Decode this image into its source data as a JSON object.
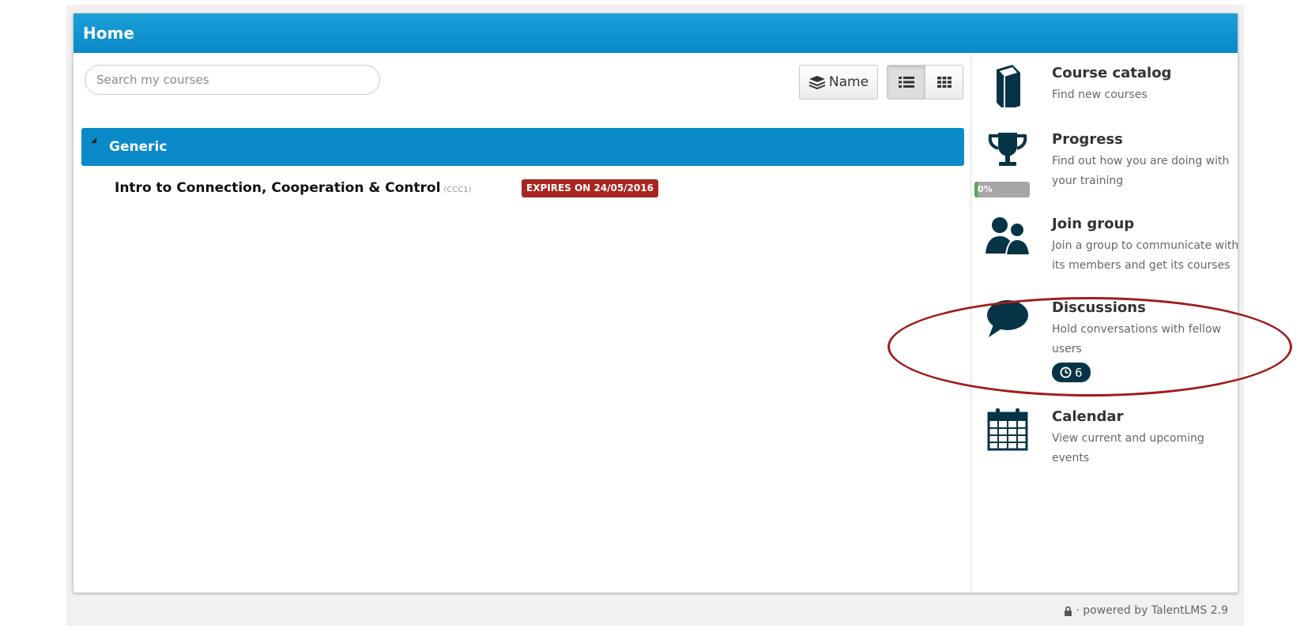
{
  "header": {
    "title": "Home"
  },
  "search": {
    "placeholder": "Search my courses"
  },
  "toolbar": {
    "sort_label": "Name"
  },
  "category": {
    "name": "Generic"
  },
  "courses": [
    {
      "title": "Intro to Connection, Cooperation & Control",
      "code": "(CCC1)",
      "expires_label": "EXPIRES ON 24/05/2016",
      "progress_label": "0%",
      "progress_value": 0.0
    }
  ],
  "sidebar": {
    "items": [
      {
        "title": "Course catalog",
        "desc": "Find new courses",
        "icon": "book-icon"
      },
      {
        "title": "Progress",
        "desc": "Find out how you are doing with your training",
        "icon": "trophy-icon"
      },
      {
        "title": "Join group",
        "desc": "Join a group to communicate with its members and get its courses",
        "icon": "users-icon"
      },
      {
        "title": "Discussions",
        "desc": "Hold conversations with fellow users",
        "icon": "speech-bubble-icon",
        "badge": "6"
      },
      {
        "title": "Calendar",
        "desc": "View current and upcoming events",
        "icon": "calendar-icon"
      }
    ]
  },
  "footer": {
    "text": "· powered by TalentLMS 2.9"
  },
  "colors": {
    "header_blue": "#0a8ac9",
    "icon_dark": "#063446",
    "expires_red": "#a8261f",
    "annotation_red": "#a01c1c"
  }
}
